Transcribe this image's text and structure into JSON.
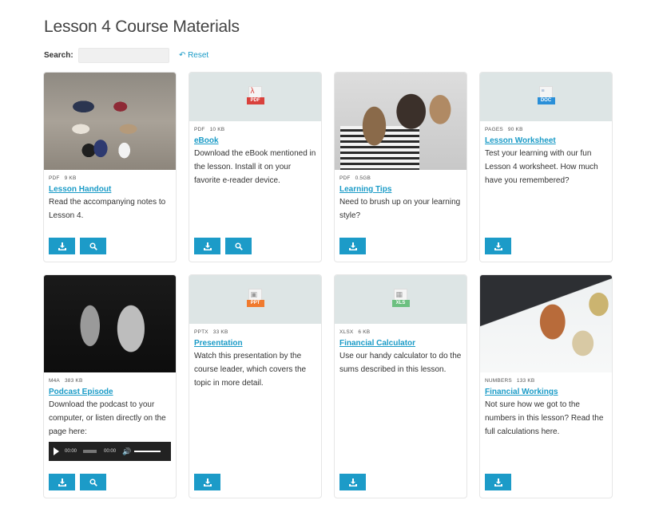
{
  "page": {
    "title": "Lesson 4 Course Materials"
  },
  "search": {
    "label": "Search:",
    "value": "",
    "placeholder": "",
    "reset_label": "Reset",
    "reset_icon": "undo-arrow-icon"
  },
  "colors": {
    "accent": "#1c9bc8",
    "link": "#1a9bc7",
    "doc_thumb_bg": "#dde5e5",
    "pdf_badge": "#d9413c",
    "doc_badge": "#2a8fd8",
    "ppt_badge": "#f07a2e",
    "xls_badge": "#6cc080"
  },
  "items": [
    {
      "thumb_type": "photo",
      "thumb_subject": "circle of shoes on cobblestones",
      "file_type": "PDF",
      "file_size": "9 KB",
      "title": "Lesson Handout",
      "description": "Read the accompanying notes to Lesson 4.",
      "buttons": [
        "download",
        "preview"
      ]
    },
    {
      "thumb_type": "file-icon",
      "icon_badge": "PDF",
      "file_type": "PDF",
      "file_size": "10 KB",
      "title": "eBook",
      "description": "Download the eBook mentioned in the lesson. Install it on your favorite e-reader device.",
      "buttons": [
        "download",
        "preview"
      ]
    },
    {
      "thumb_type": "photo",
      "thumb_subject": "audience seen from behind",
      "file_type": "PDF",
      "file_size": "0.5GB",
      "title": "Learning Tips",
      "description": "Need to brush up on your learning style?",
      "buttons": [
        "download"
      ]
    },
    {
      "thumb_type": "file-icon",
      "icon_badge": "DOC",
      "file_type": "PAGES",
      "file_size": "90 KB",
      "title": "Lesson Worksheet",
      "description": "Test your learning with our fun Lesson 4 worksheet. How much have you remembered?",
      "buttons": [
        "download"
      ]
    },
    {
      "thumb_type": "photo",
      "thumb_subject": "studio microphones",
      "file_type": "M4A",
      "file_size": "383 KB",
      "title": "Podcast Episode",
      "description": "Download the podcast to your computer, or listen directly on the page here:",
      "audio": {
        "current_time": "00:00",
        "duration": "00:00"
      },
      "buttons": [
        "download",
        "preview"
      ]
    },
    {
      "thumb_type": "file-icon",
      "icon_badge": "PPT",
      "file_type": "PPTX",
      "file_size": "33 KB",
      "title": "Presentation",
      "description": "Watch this presentation by the course leader, which covers the topic in more detail.",
      "buttons": [
        "download"
      ]
    },
    {
      "thumb_type": "file-icon",
      "icon_badge": "XLS",
      "file_type": "XLSX",
      "file_size": "6 KB",
      "title": "Financial Calculator",
      "description": "Use our handy calculator to do the sums described in this lesson.",
      "buttons": [
        "download"
      ]
    },
    {
      "thumb_type": "photo",
      "thumb_subject": "calculator and coin stacks",
      "file_type": "NUMBERS",
      "file_size": "133 KB",
      "title": "Financial Workings",
      "description": "Not sure how we got to the numbers in this lesson? Read the full calculations here.",
      "buttons": [
        "download"
      ]
    }
  ]
}
